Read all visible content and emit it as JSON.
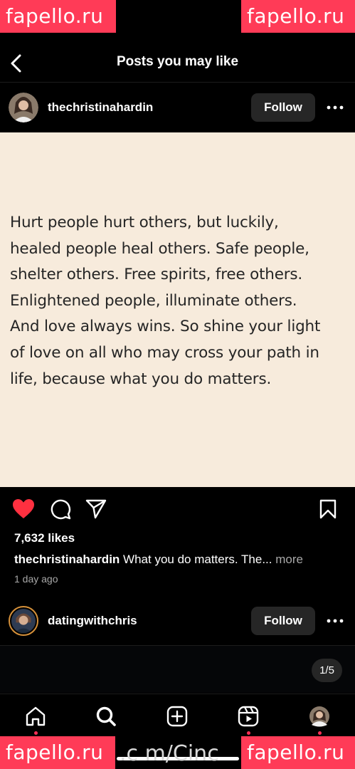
{
  "watermarks": {
    "top_left": "fapello.ru",
    "top_right": "fapello.ru",
    "bottom_left": "fapello.ru",
    "bottom_right": "fapello.ru",
    "bottom_center": ".c m/Cinc"
  },
  "header": {
    "title": "Posts you may like",
    "back_icon": "chevron-left-icon"
  },
  "post1": {
    "username": "thechristinahardin",
    "follow_label": "Follow",
    "quote": "Hurt people hurt others, but luckily,\nhealed people heal others. Safe people,\nshelter others. Free spirits, free others.\nEnlightened people, illuminate others.\nAnd love always wins. So shine your light\nof love on all who may cross your path in\nlife, because what you do matters.",
    "likes": "7,632 likes",
    "caption_user": "thechristinahardin",
    "caption_text": "What you do matters. The...",
    "caption_more": "more",
    "time": "1 day ago",
    "like_color": "#ff3040",
    "liked": true
  },
  "post2": {
    "username": "datingwithchris",
    "follow_label": "Follow",
    "counter": "1/5"
  },
  "tabbar": {
    "items": [
      "home-icon",
      "search-icon",
      "create-icon",
      "reels-icon",
      "profile-avatar"
    ],
    "active": "search-icon",
    "notification_color": "#ff2f55"
  }
}
